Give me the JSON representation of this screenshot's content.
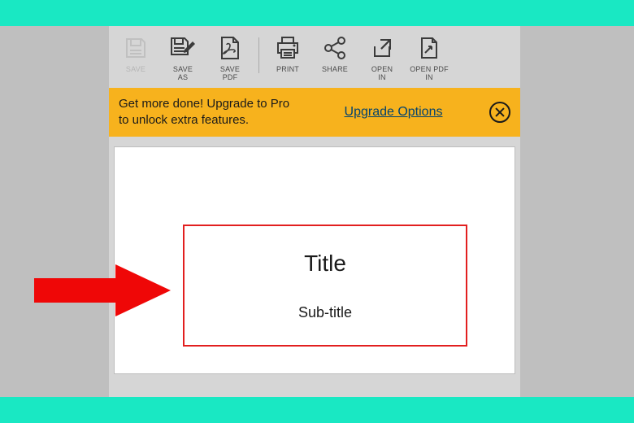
{
  "toolbar": {
    "save": "SAVE",
    "save_as": "SAVE\nAS",
    "save_pdf": "SAVE\nPDF",
    "print": "PRINT",
    "share": "SHARE",
    "open_in": "OPEN\nIN",
    "open_pdf_in": "OPEN PDF\nIN"
  },
  "banner": {
    "message": "Get more done! Upgrade to Pro to unlock extra features.",
    "link_label": "Upgrade Options"
  },
  "slide": {
    "title": "Title",
    "subtitle": "Sub-title"
  }
}
